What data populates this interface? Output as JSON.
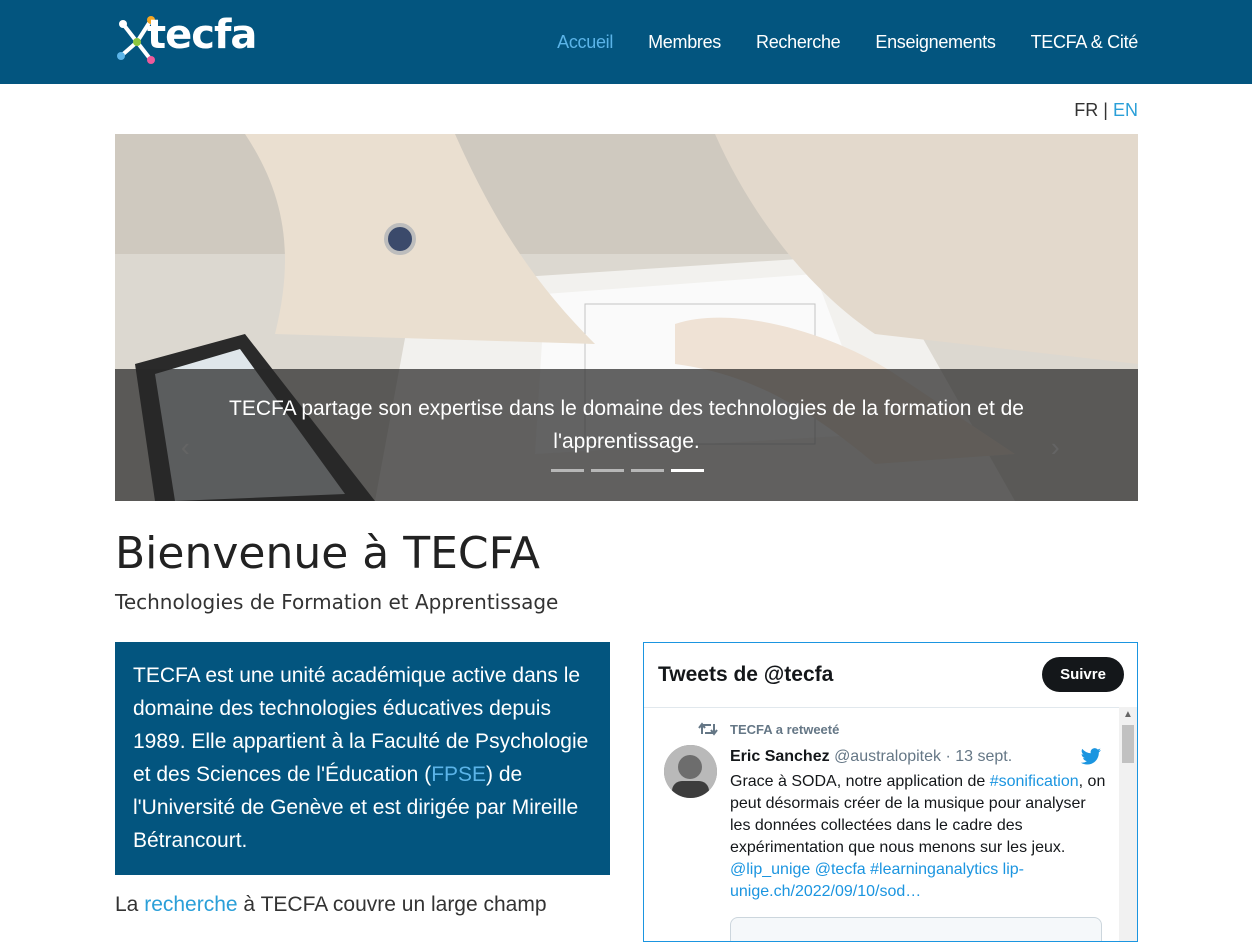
{
  "nav": {
    "logo_text": "tecfa",
    "items": [
      {
        "label": "Accueil",
        "active": true
      },
      {
        "label": "Membres",
        "active": false
      },
      {
        "label": "Recherche",
        "active": false
      },
      {
        "label": "Enseignements",
        "active": false
      },
      {
        "label": "TECFA & Cité",
        "active": false
      }
    ]
  },
  "lang": {
    "fr": "FR",
    "sep": "|",
    "en": "EN"
  },
  "carousel": {
    "caption": "TECFA partage son expertise dans le domaine des technologies de la formation et de l'apprentissage.",
    "prev_icon": "chevron-left-icon",
    "next_icon": "chevron-right-icon",
    "slide_count": 4,
    "active_slide": 4
  },
  "page": {
    "title": "Bienvenue à TECFA",
    "subtitle": "Technologies de Formation et Apprentissage"
  },
  "intro": {
    "text_before": "TECFA est une unité académique active dans le domaine des technologies éducatives depuis 1989. Elle appartient à la Faculté de Psychologie et des Sciences de l'Éducation (",
    "link": "FPSE",
    "text_after": ") de l'Université de Genève et est dirigée par Mireille Bétrancourt."
  },
  "research_para": {
    "before": "La ",
    "link": "recherche",
    "after": " à TECFA couvre un large champ"
  },
  "twitter": {
    "title": "Tweets de @tecfa",
    "follow": "Suivre",
    "retweet_label": "TECFA a retweeté",
    "author_name": "Eric Sanchez",
    "author_handle": "@australopitek",
    "date": "· 13 sept.",
    "text_before": "Grace à SODA, notre application de ",
    "hashtag1": "#sonification",
    "text_mid": ", on peut désormais créer de la musique pour analyser les données collectées dans le cadre des expérimentation que nous menons sur les jeux.",
    "links": "@lip_unige @tecfa #learninganalytics  lip-unige.ch/2022/09/10/sod…"
  },
  "colors": {
    "brand": "#03557f",
    "link": "#2a9fd8",
    "twitter": "#1b95e0"
  }
}
